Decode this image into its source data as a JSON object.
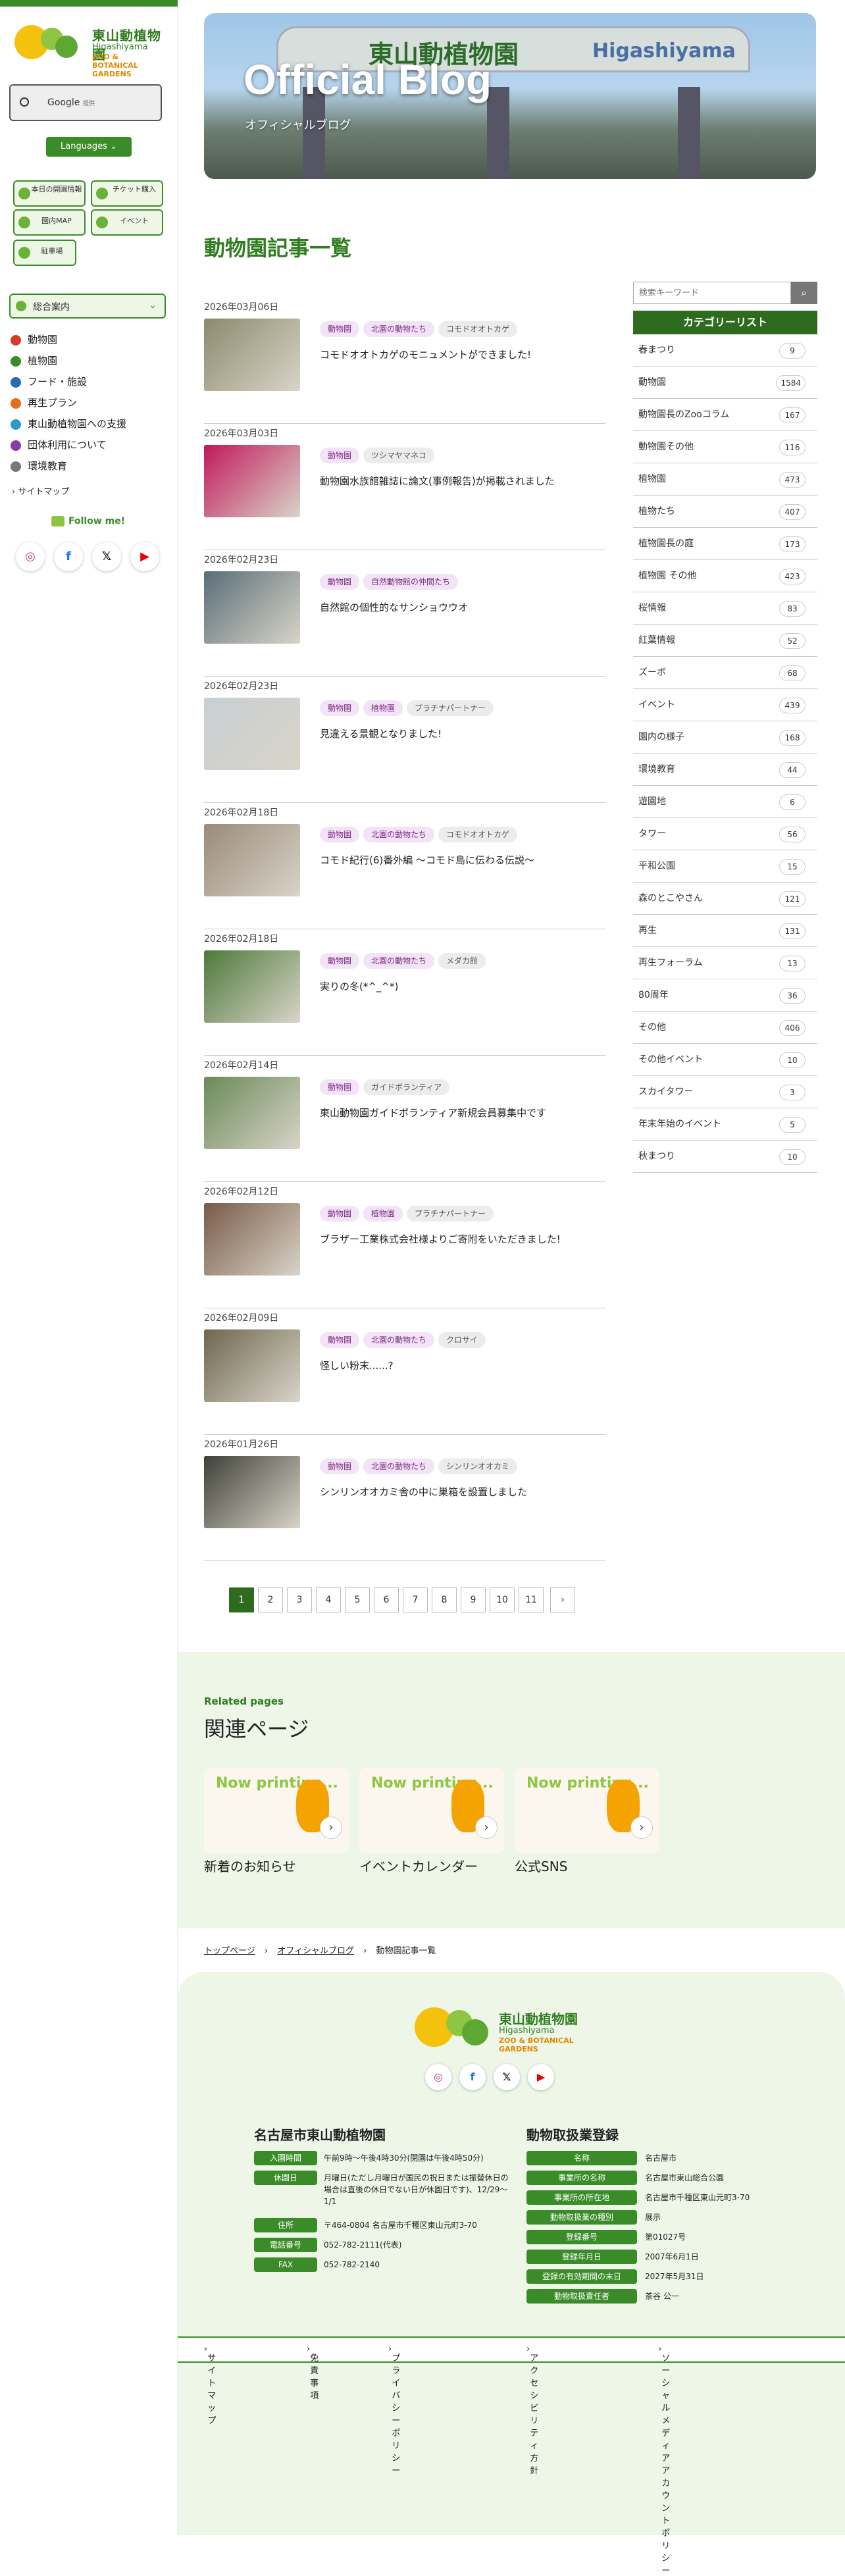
{
  "sidebar": {
    "logo": {
      "jp": "東山動植物園",
      "en": "Higashiyama",
      "sub": "ZOO & BOTANICAL GARDENS"
    },
    "google_search": {
      "label": "Google",
      "sub": "提供"
    },
    "languages": "Languages",
    "quick_links": [
      "本日の開園情報",
      "チケット購入",
      "園内MAP",
      "イベント",
      "駐車場"
    ],
    "accordion": "総合案内",
    "nav": [
      {
        "label": "動物園",
        "color": "#d93a2b"
      },
      {
        "label": "植物園",
        "color": "#3a8c28"
      },
      {
        "label": "フード・施設",
        "color": "#2a6ab3"
      },
      {
        "label": "再生プラン",
        "color": "#e0701c"
      },
      {
        "label": "東山動植物園への支援",
        "color": "#2b9bc7"
      },
      {
        "label": "団体利用について",
        "color": "#8a3aa8"
      },
      {
        "label": "環境教育",
        "color": "#777777"
      }
    ],
    "sitemap": "サイトマップ",
    "follow": "Follow me!"
  },
  "hero": {
    "title": "Official Blog",
    "subtitle": "オフィシャルブログ",
    "sign_jp": "東山動植物園",
    "sign_en": "Higashiyama"
  },
  "page_title": "動物園記事一覧",
  "posts": [
    {
      "date": "2026年03月06日",
      "tags": [
        "動物園",
        "北園の動物たち",
        "コモドオオトカゲ"
      ],
      "title": "コモドオオトカゲのモニュメントができました!"
    },
    {
      "date": "2026年03月03日",
      "tags": [
        "動物園",
        "ツシマヤマネコ"
      ],
      "title": "動物園水族館雑誌に論文(事例報告)が掲載されました"
    },
    {
      "date": "2026年02月23日",
      "tags": [
        "動物園",
        "自然動物館の仲間たち"
      ],
      "title": "自然館の個性的なサンショウウオ"
    },
    {
      "date": "2026年02月23日",
      "tags": [
        "動物園",
        "植物園",
        "プラチナパートナー"
      ],
      "title": "見違える景観となりました!"
    },
    {
      "date": "2026年02月18日",
      "tags": [
        "動物園",
        "北園の動物たち",
        "コモドオオトカゲ"
      ],
      "title": "コモド紀行(6)番外編 〜コモド島に伝わる伝説〜"
    },
    {
      "date": "2026年02月18日",
      "tags": [
        "動物園",
        "北園の動物たち",
        "メダカ館"
      ],
      "title": "実りの冬(*^_^*)"
    },
    {
      "date": "2026年02月14日",
      "tags": [
        "動物園",
        "ガイドボランティア"
      ],
      "title": "東山動物園ガイドボランティア新規会員募集中です"
    },
    {
      "date": "2026年02月12日",
      "tags": [
        "動物園",
        "植物園",
        "プラチナパートナー"
      ],
      "title": "ブラザー工業株式会社様よりご寄附をいただきました!"
    },
    {
      "date": "2026年02月09日",
      "tags": [
        "動物園",
        "北園の動物たち",
        "クロサイ"
      ],
      "title": "怪しい粉末......?"
    },
    {
      "date": "2026年01月26日",
      "tags": [
        "動物園",
        "北園の動物たち",
        "シンリンオオカミ"
      ],
      "title": "シンリンオオカミ舎の中に巣箱を設置しました"
    }
  ],
  "thumb_colors": [
    "#8c8a6e",
    "#c2185b",
    "#5a6e78",
    "#c9cfd4",
    "#9a8a7a",
    "#4e7a3a",
    "#6a8a58",
    "#7a5a48",
    "#6e6650",
    "#3e4038"
  ],
  "pager": {
    "pages": [
      "1",
      "2",
      "3",
      "4",
      "5",
      "6",
      "7",
      "8",
      "9",
      "10",
      "11"
    ],
    "next": "›",
    "current": "1"
  },
  "search": {
    "placeholder": "検索キーワード"
  },
  "categories": {
    "heading": "カテゴリーリスト",
    "items": [
      {
        "label": "春まつり",
        "count": "9"
      },
      {
        "label": "動物園",
        "count": "1584"
      },
      {
        "label": "動物園長のZooコラム",
        "count": "167"
      },
      {
        "label": "動物園その他",
        "count": "116"
      },
      {
        "label": "植物園",
        "count": "473"
      },
      {
        "label": "植物たち",
        "count": "407"
      },
      {
        "label": "植物園長の庭",
        "count": "173"
      },
      {
        "label": "植物園 その他",
        "count": "423"
      },
      {
        "label": "桜情報",
        "count": "83"
      },
      {
        "label": "紅葉情報",
        "count": "52"
      },
      {
        "label": "ズーボ",
        "count": "68"
      },
      {
        "label": "イベント",
        "count": "439"
      },
      {
        "label": "園内の様子",
        "count": "168"
      },
      {
        "label": "環境教育",
        "count": "44"
      },
      {
        "label": "遊園地",
        "count": "6"
      },
      {
        "label": "タワー",
        "count": "56"
      },
      {
        "label": "平和公園",
        "count": "15"
      },
      {
        "label": "森のとこやさん",
        "count": "121"
      },
      {
        "label": "再生",
        "count": "131"
      },
      {
        "label": "再生フォーラム",
        "count": "13"
      },
      {
        "label": "80周年",
        "count": "36"
      },
      {
        "label": "その他",
        "count": "406"
      },
      {
        "label": "その他イベント",
        "count": "10"
      },
      {
        "label": "スカイタワー",
        "count": "3"
      },
      {
        "label": "年末年始のイベント",
        "count": "5"
      },
      {
        "label": "秋まつり",
        "count": "10"
      }
    ]
  },
  "related": {
    "label_en": "Related pages",
    "heading": "関連ページ",
    "now_printing": "Now printing...",
    "cards": [
      "新着のお知らせ",
      "イベントカレンダー",
      "公式SNS"
    ]
  },
  "breadcrumb": [
    "トップページ",
    "オフィシャルブログ",
    "動物園記事一覧"
  ],
  "footer": {
    "left_heading": "名古屋市東山動植物園",
    "left_rows": [
      {
        "k": "入園時間",
        "v": "午前9時〜午後4時30分(閉園は午後4時50分)"
      },
      {
        "k": "休園日",
        "v": "月曜日(ただし月曜日が国民の祝日または振替休日の場合は直後の休日でない日が休園日です)、12/29〜1/1"
      },
      {
        "k": "住所",
        "v": "〒464-0804 名古屋市千種区東山元町3-70"
      },
      {
        "k": "電話番号",
        "v": "052-782-2111(代表)"
      },
      {
        "k": "FAX",
        "v": "052-782-2140"
      }
    ],
    "right_heading": "動物取扱業登録",
    "right_rows": [
      {
        "k": "名称",
        "v": "名古屋市"
      },
      {
        "k": "事業所の名称",
        "v": "名古屋市東山総合公園"
      },
      {
        "k": "事業所の所在地",
        "v": "名古屋市千種区東山元町3-70"
      },
      {
        "k": "動物取扱業の種別",
        "v": "展示"
      },
      {
        "k": "登録番号",
        "v": "第01027号"
      },
      {
        "k": "登録年月日",
        "v": "2007年6月1日"
      },
      {
        "k": "登録の有効期間の末日",
        "v": "2027年5月31日"
      },
      {
        "k": "動物取扱責任者",
        "v": "茶谷 公一"
      }
    ],
    "links": [
      "サイトマップ",
      "免責事項",
      "プライバシーポリシー",
      "アクセシビリティ方針",
      "ソーシャルメディアアカウントポリシー"
    ]
  },
  "social_icons": [
    "instagram-icon",
    "facebook-icon",
    "x-icon",
    "youtube-icon"
  ]
}
